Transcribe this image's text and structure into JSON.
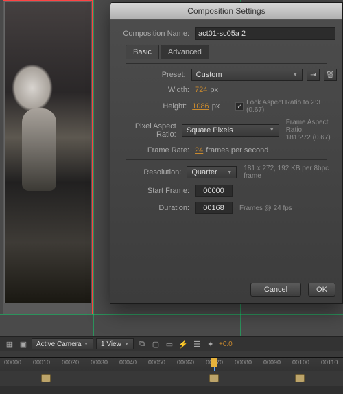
{
  "dialog": {
    "title": "Composition Settings",
    "name_label": "Composition Name:",
    "name_value": "act01-sc05a 2",
    "tabs": {
      "basic": "Basic",
      "advanced": "Advanced"
    },
    "preset_label": "Preset:",
    "preset_value": "Custom",
    "width_label": "Width:",
    "width_value": "724",
    "height_label": "Height:",
    "height_value": "1086",
    "px_unit": "px",
    "lock_label": "Lock Aspect Ratio to 2:3 (0.67)",
    "par_label": "Pixel Aspect Ratio:",
    "par_value": "Square Pixels",
    "far_label": "Frame Aspect Ratio:",
    "far_value": "181:272 (0.67)",
    "fps_label": "Frame Rate:",
    "fps_value": "24",
    "fps_unit": "frames per second",
    "res_label": "Resolution:",
    "res_value": "Quarter",
    "res_info": "181 x 272, 192 KB per 8bpc frame",
    "start_label": "Start Frame:",
    "start_value": "00000",
    "dur_label": "Duration:",
    "dur_value": "00168",
    "dur_info": "Frames @ 24 fps",
    "cancel": "Cancel",
    "ok": "OK"
  },
  "toolbar": {
    "camera": "Active Camera",
    "view": "1 View",
    "exposure": "+0.0"
  },
  "timeline": {
    "ticks": [
      "00000",
      "00010",
      "00020",
      "00030",
      "00040",
      "00050",
      "00060",
      "00070",
      "00080",
      "00090",
      "00100",
      "00110"
    ]
  }
}
